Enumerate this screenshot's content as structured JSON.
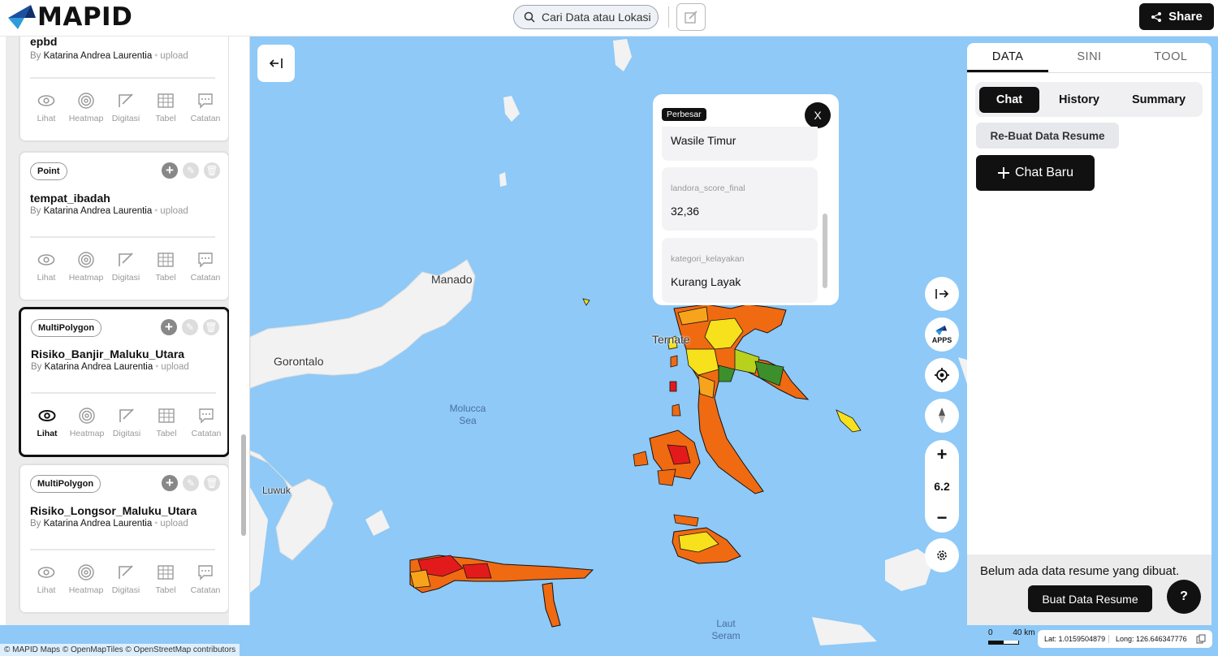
{
  "topbar": {
    "logo": "MAPID",
    "search_placeholder": "Cari Data atau Lokasi",
    "share_label": "Share"
  },
  "layers": [
    {
      "type": "",
      "title": "epbd",
      "author": "Katarina Andrea Laurentia",
      "source": "upload",
      "selected": false,
      "active_tool": ""
    },
    {
      "type": "Point",
      "title": "tempat_ibadah",
      "author": "Katarina Andrea Laurentia",
      "source": "upload",
      "selected": false,
      "active_tool": ""
    },
    {
      "type": "MultiPolygon",
      "title": "Risiko_Banjir_Maluku_Utara",
      "author": "Katarina Andrea Laurentia",
      "source": "upload",
      "selected": true,
      "active_tool": "Lihat"
    },
    {
      "type": "MultiPolygon",
      "title": "Risiko_Longsor_Maluku_Utara",
      "author": "Katarina Andrea Laurentia",
      "source": "upload",
      "selected": false,
      "active_tool": ""
    }
  ],
  "tools": [
    "Lihat",
    "Heatmap",
    "Digitasi",
    "Tabel",
    "Catatan"
  ],
  "by_label": "By",
  "popup": {
    "badge": "Perbesar",
    "close": "X",
    "items": [
      {
        "key": "",
        "value": "Wasile Timur"
      },
      {
        "key": "landora_score_final",
        "value": "32,36"
      },
      {
        "key": "kategori_kelayakan",
        "value": "Kurang Layak"
      }
    ]
  },
  "map": {
    "places": [
      {
        "name": "Manado"
      },
      {
        "name": "Gorontalo"
      },
      {
        "name": "Luwuk"
      },
      {
        "name": "Ternate"
      }
    ],
    "seas": [
      {
        "name": "Molucca Sea"
      },
      {
        "name": "Laut Seram"
      }
    ],
    "attribution": "© MAPID Maps © OpenMapTiles © OpenStreetMap contributors",
    "zoom": "6.2",
    "scale_start": "0",
    "scale_label": "40 km",
    "lat": "Lat: 1.0159504879",
    "long": "Long: 126.646347776"
  },
  "controls": {
    "apps_label": "APPS",
    "zoom_in": "+",
    "zoom_out": "−"
  },
  "right_panel": {
    "tabs": [
      "DATA",
      "SINI",
      "TOOL"
    ],
    "active_tab": "DATA",
    "subtabs": [
      "Chat",
      "History",
      "Summary"
    ],
    "rebuat_label": "Re-Buat Data Resume",
    "chat_baru_label": "Chat Baru",
    "empty_text": "Belum ada data resume yang dibuat.",
    "buat_label": "Buat Data Resume",
    "help": "?"
  },
  "colors": {
    "very_high": "#e31a1c",
    "high": "#f06a12",
    "medium": "#f7a41c",
    "low": "#f7e01c",
    "fair": "#b7d11c",
    "good": "#3c8f2b",
    "land": "#f2f2f2",
    "water": "#8ec9f7"
  }
}
